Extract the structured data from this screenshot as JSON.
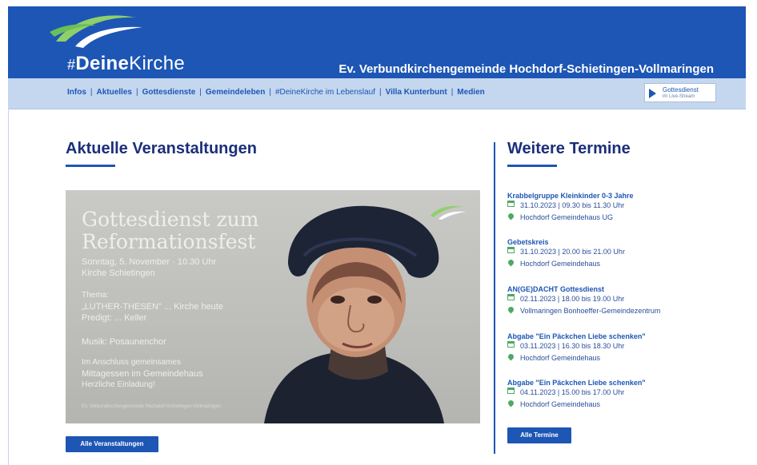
{
  "header": {
    "logo_hash": "#",
    "logo_deine": "Deine",
    "logo_kirche": "Kirche",
    "parish_name": "Ev. Verbundkirchengemeinde Hochdorf-Schietingen-Vollmaringen"
  },
  "nav": {
    "items": [
      "Infos",
      "Aktuelles",
      "Gottesdienste",
      "Gemeindeleben",
      "#DeineKirche im Lebenslauf",
      "Villa Kunterbunt",
      "Medien"
    ],
    "separator": "|",
    "live_button": {
      "line1": "Gottesdienst",
      "line2": "im Live-Stream"
    }
  },
  "main": {
    "heading": "Aktuelle Veranstaltungen",
    "poster": {
      "title_line1": "Gottesdienst zum",
      "title_line2": "Reformationsfest",
      "date_line": "Sonntag, 5. November · 10.30 Uhr",
      "place_line": "Kirche Schietingen",
      "theme_label": "Thema:",
      "theme_title": "„LUTHER-THESEN\" ... Kirche heute",
      "speaker": "Predigt: ... Keller",
      "music": "Musik: Posaunenchor",
      "after_label": "Im Anschluss gemeinsames",
      "after_lunch": "Mittagessen im Gemeindehaus",
      "after_note": "Herzliche Einladung!",
      "fineprint": "Ev. Verbundkirchengemeinde Hochdorf-Schietingen-Vollmaringen"
    },
    "button_label": "Alle Veranstaltungen"
  },
  "sidebar": {
    "heading": "Weitere Termine",
    "events": [
      {
        "title": "Krabbelgruppe Kleinkinder 0-3 Jahre",
        "date": "31.10.2023 | 09.30 bis 11.30 Uhr",
        "location": "Hochdorf Gemeindehaus UG"
      },
      {
        "title": "Gebetskreis",
        "date": "31.10.2023 | 20.00 bis 21.00 Uhr",
        "location": "Hochdorf Gemeindehaus"
      },
      {
        "title": "AN(GE)DACHT Gottesdienst",
        "date": "02.11.2023 | 18.00 bis 19.00 Uhr",
        "location": "Vollmaringen Bonhoeffer-Gemeindezentrum"
      },
      {
        "title": "Abgabe \"Ein Päckchen Liebe schenken\"",
        "date": "03.11.2023 | 16.30 bis 18.30 Uhr",
        "location": "Hochdorf Gemeindehaus"
      },
      {
        "title": "Abgabe \"Ein Päckchen Liebe schenken\"",
        "date": "04.11.2023 | 15.00 bis 17.00 Uhr",
        "location": "Hochdorf Gemeindehaus"
      }
    ],
    "button_label": "Alle Termine"
  },
  "colors": {
    "brand_blue": "#1d56b4",
    "nav_bg": "#c4d7ef",
    "heading": "#1b2f7a",
    "icon_green": "#4caa62",
    "logo_green": "#8fd06b"
  }
}
